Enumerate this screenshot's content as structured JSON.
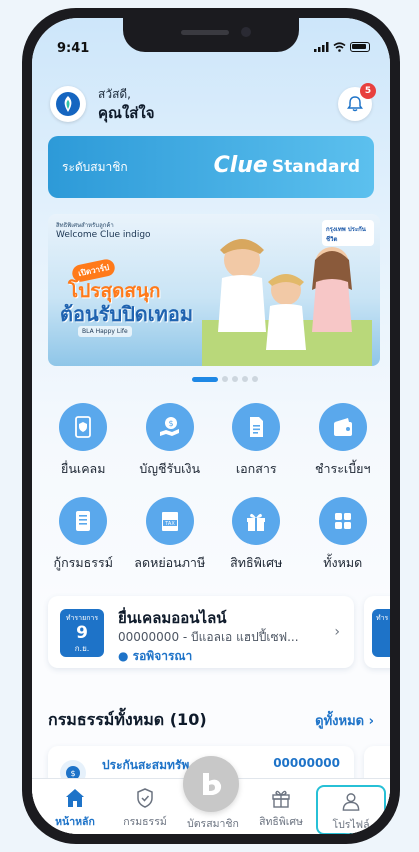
{
  "status": {
    "time": "9:41"
  },
  "header": {
    "greeting": "สวัสดี,",
    "name": "คุณใส่ใจ",
    "notifications": "5"
  },
  "member": {
    "label": "ระดับสมาชิก",
    "brand": "Clue",
    "tier": "Standard"
  },
  "banner": {
    "small_text": "สิทธิพิเศษสำหรับลูกค้า",
    "welcome": "Welcome  Clue  indigo",
    "pill": "เปิดวาร์ป",
    "headline_1": "โปรสุดสนุก",
    "headline_2": "ต้อนรับปิดเทอม",
    "sub": "BLA Happy Life",
    "corner": "กรุงเทพ ประกันชีวิต"
  },
  "carousel": {
    "count": 5,
    "active": 0
  },
  "menu": [
    {
      "label": "ยื่นเคลม",
      "icon": "claim-document-icon"
    },
    {
      "label": "บัญชีรับเงิน",
      "icon": "receive-money-icon"
    },
    {
      "label": "เอกสาร",
      "icon": "document-icon"
    },
    {
      "label": "ชำระเบี้ยฯ",
      "icon": "wallet-icon"
    },
    {
      "label": "กู้กรมธรรม์",
      "icon": "policy-loan-icon"
    },
    {
      "label": "ลดหย่อนภาษี",
      "icon": "tax-icon"
    },
    {
      "label": "สิทธิพิเศษ",
      "icon": "gift-icon"
    },
    {
      "label": "ทั้งหมด",
      "icon": "all-apps-icon"
    }
  ],
  "claim": {
    "date_label": "ทำรายการ",
    "day": "9",
    "month": "ก.ย.",
    "title": "ยื่นเคลมออนไลน์",
    "description": "00000000 - บีแอลเอ แฮปปี้เซฟ...",
    "status": "● รอพิจารณา",
    "next_label": "ทำร"
  },
  "policies": {
    "title": "กรมธรรม์ทั้งหมด (10)",
    "see_all": "ดูทั้งหมด  ›",
    "first_name": "ประกันสะสมทรัพ",
    "first_number": "00000000"
  },
  "tabbar": [
    {
      "label": "หน้าหลัก",
      "icon": "home-icon",
      "active": true
    },
    {
      "label": "กรมธรรม์",
      "icon": "shield-icon"
    },
    {
      "label": "บัตรสมาชิก",
      "icon": "member-card-icon"
    },
    {
      "label": "สิทธิพิเศษ",
      "icon": "gift-icon"
    },
    {
      "label": "โปรไฟล์",
      "icon": "profile-icon",
      "highlight": true
    }
  ],
  "colors": {
    "accent": "#1e73c8",
    "icon_bg": "#5aa8ec",
    "member_card": "#2d9ad8",
    "badge": "#e8403e",
    "highlight_border": "#27c0d6"
  }
}
